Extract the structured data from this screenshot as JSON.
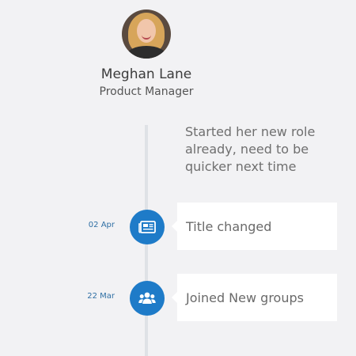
{
  "profile": {
    "name": "Meghan Lane",
    "title": "Product Manager",
    "avatar_icon": "user-avatar"
  },
  "timeline": {
    "intro_text": "Started her new role already, need to be quicker next time",
    "events": [
      {
        "date": "02 Apr",
        "label": "Title changed",
        "icon": "newspaper-icon"
      },
      {
        "date": "22 Mar",
        "label": "Joined New groups",
        "icon": "users-icon"
      }
    ]
  },
  "colors": {
    "background": "#f2f2f4",
    "accent": "#1e7bc8",
    "line": "#dfe2e6",
    "date_text": "#2f6fa4"
  }
}
